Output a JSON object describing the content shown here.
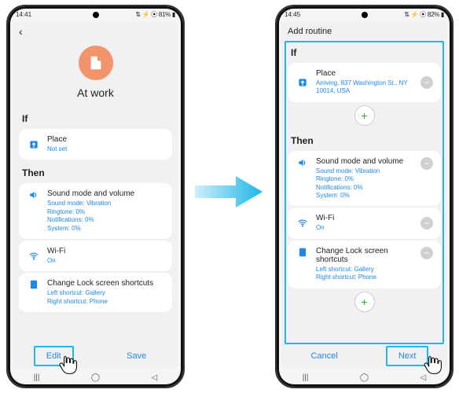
{
  "left": {
    "status": {
      "time": "14:41",
      "indicators": "⚙ ❖ ⬚ ▾ •",
      "right": "⇅ ⚡ ⦿ 81% ▮"
    },
    "back_icon": "‹",
    "hero": {
      "title": "At work",
      "icon_name": "building-icon"
    },
    "if_label": "If",
    "place": {
      "title": "Place",
      "sub": "Not set"
    },
    "then_label": "Then",
    "sound": {
      "title": "Sound mode and volume",
      "l1": "Sound mode: Vibration",
      "l2": "Ringtone: 0%",
      "l3": "Notifications: 0%",
      "l4": "System: 0%"
    },
    "wifi": {
      "title": "Wi-Fi",
      "sub": "On"
    },
    "lock": {
      "title": "Change Lock screen shortcuts",
      "l1": "Left shortcut: Gallery",
      "l2": "Right shortcut: Phone"
    },
    "edit": "Edit",
    "save": "Save"
  },
  "right": {
    "status": {
      "time": "14:45",
      "indicators": "⬚ ⚙ ▾ •",
      "right": "⇅ ⚡ ⦿ 82% ▮"
    },
    "title": "Add routine",
    "if_label": "If",
    "place": {
      "title": "Place",
      "sub": "Arriving, 837 Washington St., NY 10014, USA"
    },
    "then_label": "Then",
    "sound": {
      "title": "Sound mode and volume",
      "l1": "Sound mode: Vibration",
      "l2": "Ringtone: 0%",
      "l3": "Notifications: 0%",
      "l4": "System: 0%"
    },
    "wifi": {
      "title": "Wi-Fi",
      "sub": "On"
    },
    "lock": {
      "title": "Change Lock screen shortcuts",
      "l1": "Left shortcut: Gallery",
      "l2": "Right shortcut: Phone"
    },
    "cancel": "Cancel",
    "next": "Next",
    "plus": "+"
  }
}
